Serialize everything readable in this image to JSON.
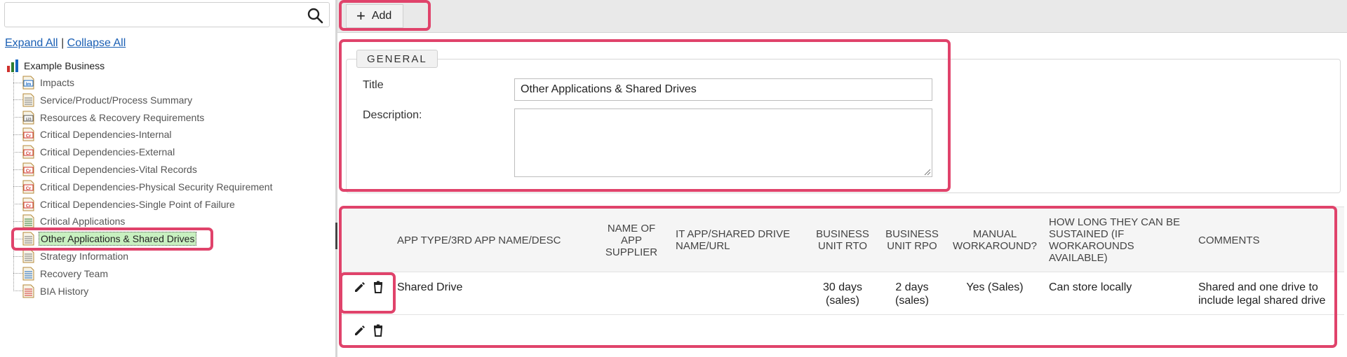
{
  "tree": {
    "search": {
      "value": "",
      "placeholder": "",
      "icon": "search-icon"
    },
    "expand_all": "Expand All",
    "separator": "|",
    "collapse_all": "Collapse All",
    "root": {
      "label": "Example Business",
      "icon": "bar-chart-icon"
    },
    "items": [
      {
        "label": "Impacts",
        "icon": "im-doc-icon"
      },
      {
        "label": "Service/Product/Process Summary",
        "icon": "text-doc-icon"
      },
      {
        "label": "Resources & Recovery Requirements",
        "icon": "numbers-doc-icon"
      },
      {
        "label": "Critical Dependencies-Internal",
        "icon": "cr-doc-icon"
      },
      {
        "label": "Critical Dependencies-External",
        "icon": "cr-doc-icon"
      },
      {
        "label": "Critical Dependencies-Vital Records",
        "icon": "cr-doc-icon"
      },
      {
        "label": "Critical Dependencies-Physical Security Requirement",
        "icon": "cr-doc-icon"
      },
      {
        "label": "Critical Dependencies-Single Point of Failure",
        "icon": "cr-doc-icon"
      },
      {
        "label": "Critical Applications",
        "icon": "app-doc-icon"
      },
      {
        "label": "Other Applications & Shared Drives",
        "icon": "text-doc-icon",
        "selected": true
      },
      {
        "label": "Strategy Information",
        "icon": "text-doc-icon"
      },
      {
        "label": "Recovery Team",
        "icon": "person-doc-icon"
      },
      {
        "label": "BIA History",
        "icon": "history-doc-icon"
      }
    ]
  },
  "toolbar": {
    "add_label": "Add",
    "add_icon": "plus-icon"
  },
  "general": {
    "legend": "GENERAL",
    "title_label": "Title",
    "title_value": "Other Applications & Shared Drives",
    "description_label": "Description:",
    "description_value": ""
  },
  "grid": {
    "columns": [
      "APP TYPE/3RD APP NAME/DESC",
      "NAME OF APP SUPPLIER",
      "IT APP/SHARED DRIVE NAME/URL",
      "BUSINESS UNIT RTO",
      "BUSINESS UNIT RPO",
      "MANUAL WORKAROUND?",
      "HOW LONG THEY CAN BE SUSTAINED (IF WORKAROUNDS AVAILABLE)",
      "COMMENTS"
    ],
    "rows": [
      {
        "app_type": "Shared Drive",
        "supplier": "",
        "it_app": "",
        "rto": "30 days (sales)",
        "rpo": "2 days (sales)",
        "workaround": "Yes (Sales)",
        "sustained": "Can store locally",
        "comments": "Shared and one drive to include legal shared drive"
      },
      {
        "app_type": "",
        "supplier": "",
        "it_app": "",
        "rto": "",
        "rpo": "",
        "workaround": "",
        "sustained": "",
        "comments": ""
      }
    ],
    "edit_icon": "pencil-icon",
    "delete_icon": "trash-icon"
  },
  "colors": {
    "highlight": "#e0436b",
    "selected_bg": "#c8f0c0",
    "link": "#1a5fb4"
  }
}
